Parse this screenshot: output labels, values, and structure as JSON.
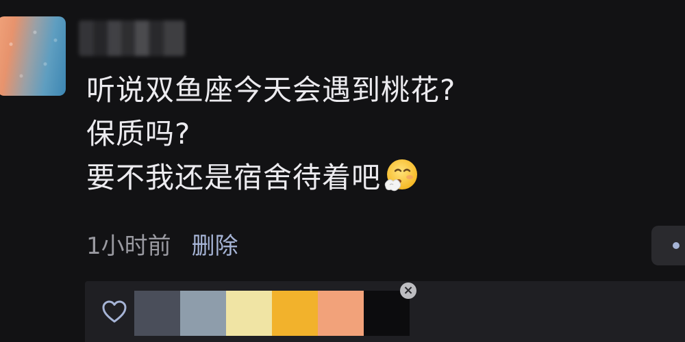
{
  "comment": {
    "lines": [
      "听说双鱼座今天会遇到桃花?",
      "保质吗?",
      "要不我还是宿舍待着吧"
    ],
    "emoji": "sick-sneezing-face"
  },
  "meta": {
    "time": "1小时前",
    "delete_label": "删除"
  },
  "palette": {
    "colors": [
      "#4a4e5a",
      "#8e9dab",
      "#f0e4a4",
      "#f2b22c",
      "#f2a27a",
      "#0c0c0e"
    ],
    "close_label": "×"
  },
  "icons": {
    "like": "heart-outline-icon",
    "more": "dot-menu-icon"
  },
  "theme": {
    "background": "#121214",
    "text": "#ecebef",
    "muted": "#9a9aa1",
    "link": "#a6b4d6"
  }
}
